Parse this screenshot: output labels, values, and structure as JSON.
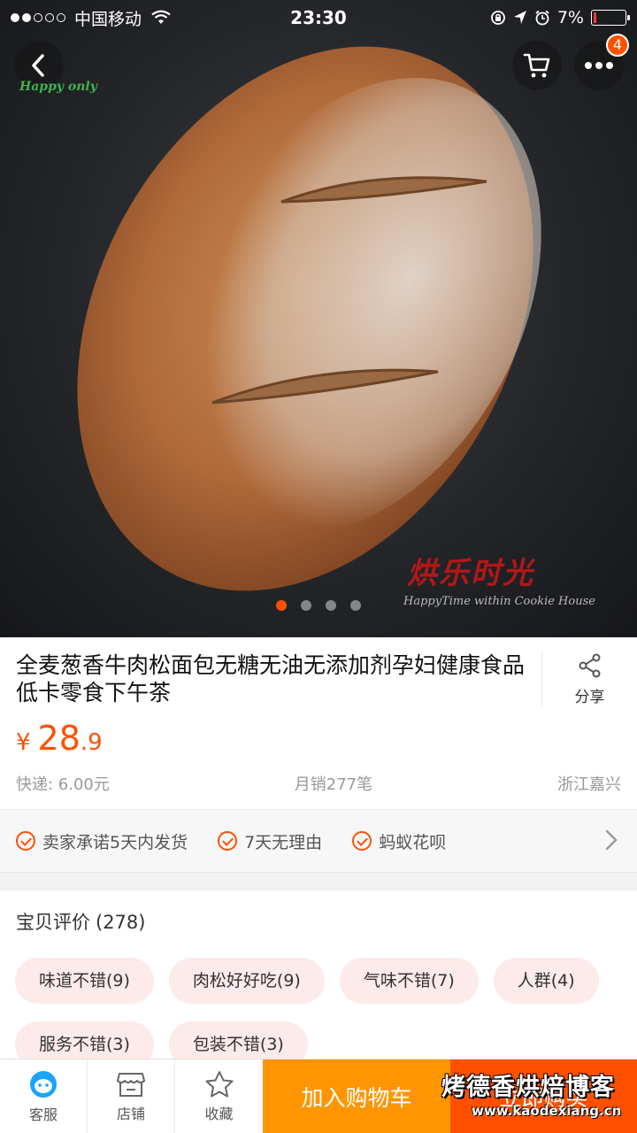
{
  "status_bar": {
    "carrier": "中国移动",
    "time": "23:30",
    "battery": "7%",
    "battery_level": 0.07
  },
  "header": {
    "cart_badge": "4",
    "logo_text": "Happy only"
  },
  "hero": {
    "carousel_count": 4,
    "active_index": 0,
    "watermark": "烘乐时光",
    "watermark_sub": "HappyTime within Cookie House"
  },
  "product": {
    "title": "全麦葱香牛肉松面包无糖无油无添加剂孕妇健康食品低卡零食下午茶",
    "share_label": "分享",
    "price_currency": "¥",
    "price_integer": "28",
    "price_decimal": ".9",
    "shipping": "快递: 6.00元",
    "monthly_sales": "月销277笔",
    "location": "浙江嘉兴"
  },
  "services": [
    {
      "label": "卖家承诺5天内发货"
    },
    {
      "label": "7天无理由"
    },
    {
      "label": "蚂蚁花呗"
    }
  ],
  "reviews": {
    "title": "宝贝评价",
    "count": "(278)",
    "tags": [
      "味道不错(9)",
      "肉松好好吃(9)",
      "气味不错(7)",
      "人群(4)",
      "服务不错(3)",
      "包装不错(3)"
    ]
  },
  "bottom_bar": {
    "service_label": "客服",
    "shop_label": "店铺",
    "favorite_label": "收藏",
    "add_to_cart_label": "加入购物车",
    "buy_now_label": "立即购买"
  },
  "corner_watermark": {
    "line1": "烤德香烘焙博客",
    "line2": "www.kaodexiang.cn"
  },
  "colors": {
    "accent": "#ff5000",
    "cart_button": "#ff9500",
    "tag_bg": "#fdeaea"
  }
}
